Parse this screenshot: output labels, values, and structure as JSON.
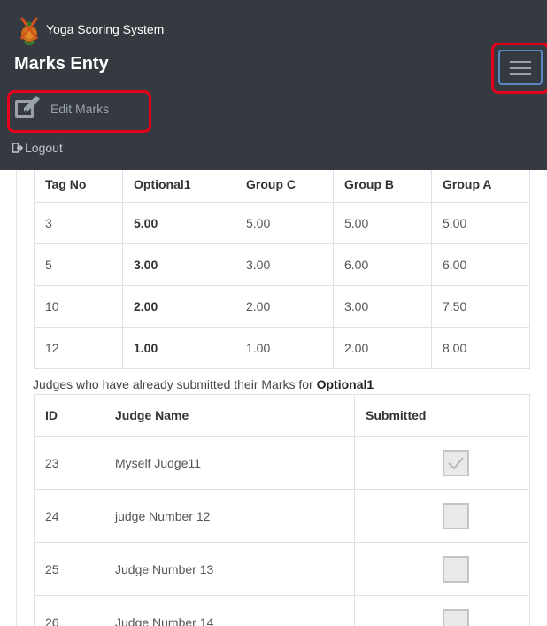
{
  "navbar": {
    "brand_text": "Yoga Scoring System",
    "page_title": "Marks Enty",
    "menu_toggle_icon": "hamburger-icon",
    "edit_label": "Edit Marks",
    "edit_icon": "edit-icon",
    "logout_label": "Logout",
    "logout_icon": "logout-icon",
    "highlight_color": "#e3001b"
  },
  "marks_table": {
    "headers": [
      "Tag No",
      "Optional1",
      "Group C",
      "Group B",
      "Group A"
    ],
    "rows": [
      [
        "3",
        "5.00",
        "5.00",
        "5.00",
        "5.00"
      ],
      [
        "5",
        "3.00",
        "3.00",
        "6.00",
        "6.00"
      ],
      [
        "10",
        "2.00",
        "2.00",
        "3.00",
        "7.50"
      ],
      [
        "12",
        "1.00",
        "1.00",
        "2.00",
        "8.00"
      ]
    ]
  },
  "judges": {
    "caption_prefix": "Judges who have already submitted their Marks for",
    "caption_event": "Optional1",
    "headers": [
      "ID",
      "Judge Name",
      "Submitted"
    ],
    "rows": [
      [
        "23",
        "Myself Judge11"
      ],
      [
        "24",
        "judge Number 12"
      ],
      [
        "25",
        "Judge Number 13"
      ],
      [
        "26",
        "Judge Number 14"
      ]
    ],
    "submitted": [
      true,
      false,
      false,
      false
    ]
  }
}
